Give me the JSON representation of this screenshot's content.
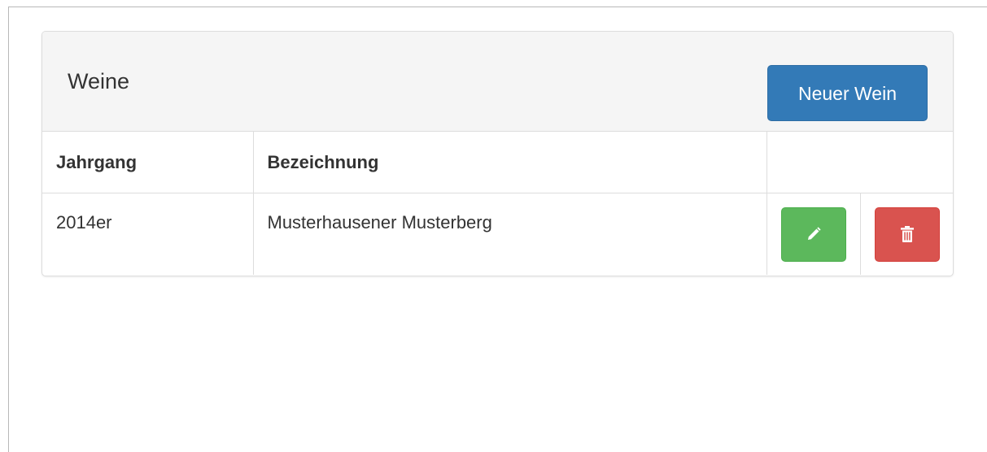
{
  "panel": {
    "title": "Weine",
    "new_button_label": "Neuer Wein"
  },
  "table": {
    "columns": [
      "Jahrgang",
      "Bezeichnung",
      ""
    ],
    "rows": [
      {
        "jahrgang": "2014er",
        "bezeichnung": "Musterhausener Musterberg",
        "actions": [
          {
            "icon": "pencil-icon",
            "color": "#5cb85c"
          },
          {
            "icon": "trash-icon",
            "color": "#d9534f"
          }
        ]
      }
    ]
  },
  "colors": {
    "primary": "#337ab7",
    "success": "#5cb85c",
    "danger": "#d9534f",
    "panel_heading_bg": "#f5f5f5",
    "border": "#dddddd"
  }
}
